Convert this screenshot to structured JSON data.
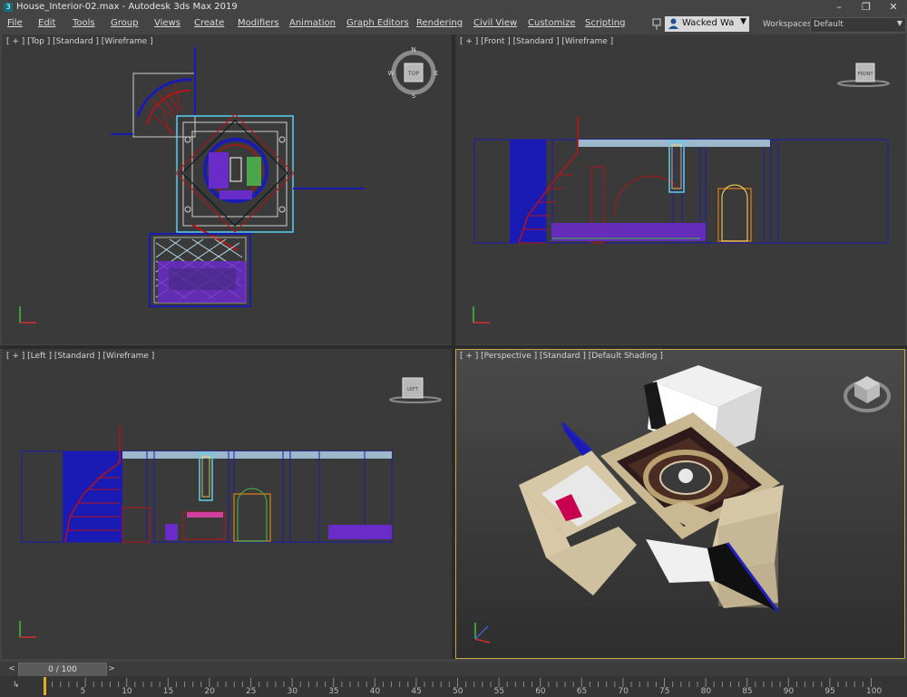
{
  "window": {
    "title": "House_Interior-02.max - Autodesk 3ds Max 2019",
    "app_icon": "3ds-max-icon",
    "controls": {
      "minimize": "–",
      "maximize": "❐",
      "close": "✕"
    }
  },
  "menu": {
    "items": [
      "File",
      "Edit",
      "Tools",
      "Group",
      "Views",
      "Create",
      "Modifiers",
      "Animation",
      "Graph Editors",
      "Rendering",
      "Civil View",
      "Customize",
      "Scripting"
    ],
    "user": "Wacked Wa",
    "workspaces_label": "Workspaces:",
    "workspace_value": "Default"
  },
  "viewports": {
    "top": {
      "label": "[ + ] [Top ] [Standard ] [Wireframe ]",
      "viewcube": {
        "n": "N",
        "s": "S",
        "e": "E",
        "w": "W",
        "face": "TOP"
      }
    },
    "front": {
      "label": "[ + ] [Front ] [Standard ] [Wireframe ]",
      "viewcube": {
        "face": "FRONT"
      }
    },
    "left": {
      "label": "[ + ] [Left ] [Standard ] [Wireframe ]",
      "viewcube": {
        "face": "LEFT"
      }
    },
    "perspective": {
      "label": "[ + ] [Perspective ] [Standard ] [Default Shading ]"
    }
  },
  "timeline": {
    "frame_display": "0 / 100",
    "current_frame": 0,
    "total_frames": 100,
    "tick_labels": [
      "5",
      "10",
      "15",
      "20",
      "25",
      "30",
      "35",
      "40",
      "45",
      "50",
      "55",
      "60",
      "65",
      "70",
      "75",
      "80",
      "85",
      "90",
      "95",
      "100"
    ]
  },
  "colors": {
    "accent_active_viewport": "#c8a84a",
    "wire_blue": "#1a1ab4",
    "wire_red": "#b41414",
    "wire_purple": "#6a2cc8",
    "wire_cyan": "#58d0f0",
    "playhead": "#e0b020"
  }
}
